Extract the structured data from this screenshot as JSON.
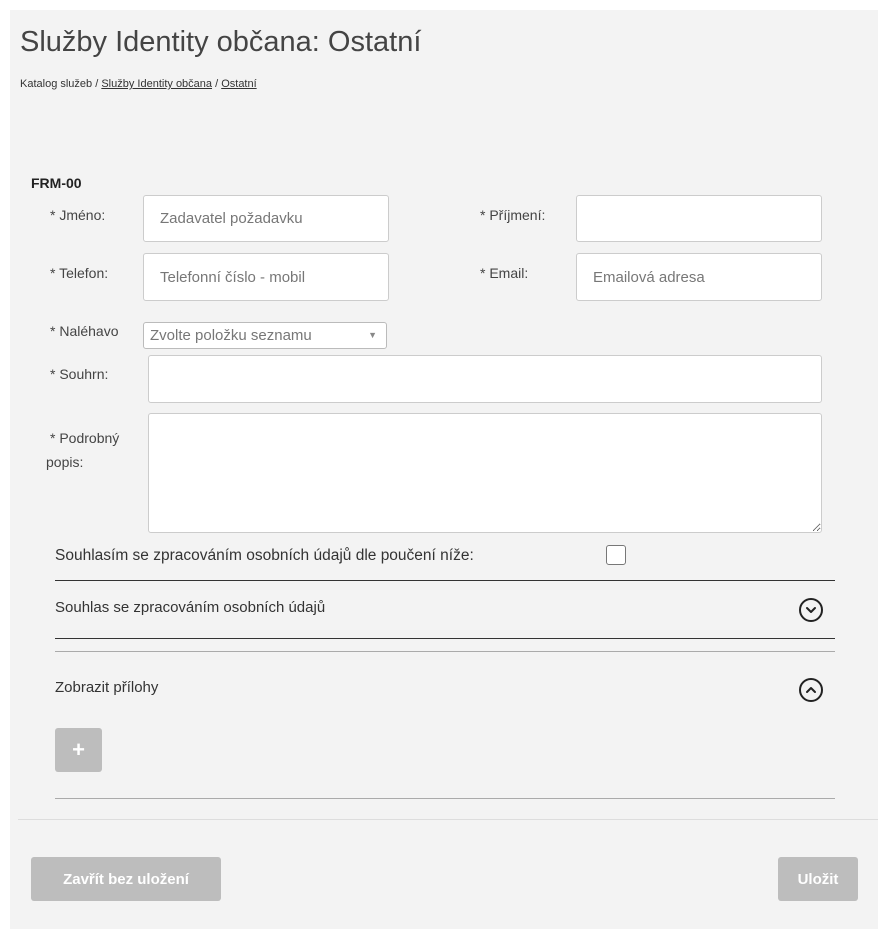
{
  "page": {
    "title": "Služby Identity občana: Ostatní",
    "breadcrumb": {
      "root": "Katalog služeb",
      "sep1": " / ",
      "link1": "Služby Identity občana",
      "sep2": " / ",
      "link2": "Ostatní"
    }
  },
  "form": {
    "code": "FRM-00",
    "first_name": {
      "label": "* Jméno:",
      "placeholder": "Zadavatel požadavku",
      "value": ""
    },
    "last_name": {
      "label": "* Příjmení:",
      "placeholder": "",
      "value": ""
    },
    "phone": {
      "label": "* Telefon:",
      "placeholder": "Telefonní číslo - mobil",
      "value": ""
    },
    "email": {
      "label": "* Email:",
      "placeholder": "Emailová adresa",
      "value": ""
    },
    "urgency": {
      "label": "* Naléhavo",
      "selected": "Zvolte položku seznamu"
    },
    "summary": {
      "label": "* Souhrn:",
      "value": ""
    },
    "description": {
      "label_line1": "* Podrobný",
      "label_line2": "popis:",
      "value": ""
    },
    "consent": {
      "label": "Souhlasím se zpracováním osobních údajů dle poučení níže:",
      "checked": false
    },
    "consent_section": {
      "label": "Souhlas se zpracováním osobních údajů",
      "icon": "chevron-down-circle"
    },
    "attachments_section": {
      "label": "Zobrazit přílohy",
      "icon": "chevron-up-circle",
      "add_label": "+"
    }
  },
  "footer": {
    "close_label": "Zavřít bez uložení",
    "save_label": "Uložit"
  }
}
